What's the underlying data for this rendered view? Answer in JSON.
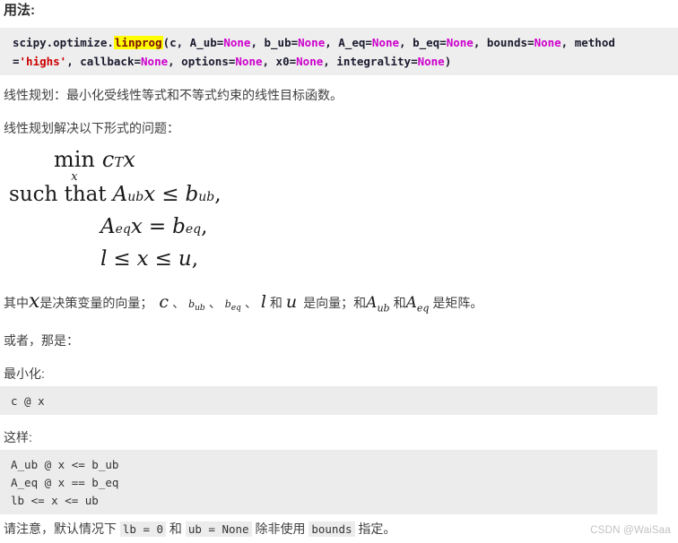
{
  "heading": "用法:",
  "signature": {
    "module_prefix": "scipy.optimize.",
    "func_name": "linprog",
    "open_paren": "(",
    "line1_segments": [
      {
        "t": "c, A_ub=",
        "k": "plain"
      },
      {
        "t": "None",
        "k": "none"
      },
      {
        "t": ", b_ub=",
        "k": "plain"
      },
      {
        "t": "None",
        "k": "none"
      },
      {
        "t": ", A_eq=",
        "k": "plain"
      },
      {
        "t": "None",
        "k": "none"
      },
      {
        "t": ", b_eq=",
        "k": "plain"
      },
      {
        "t": "None",
        "k": "none"
      },
      {
        "t": ", bounds=",
        "k": "plain"
      },
      {
        "t": "None",
        "k": "none"
      },
      {
        "t": ", method",
        "k": "plain"
      }
    ],
    "line2_segments": [
      {
        "t": "=",
        "k": "plain"
      },
      {
        "t": "'highs'",
        "k": "str"
      },
      {
        "t": ", callback=",
        "k": "plain"
      },
      {
        "t": "None",
        "k": "none"
      },
      {
        "t": ", options=",
        "k": "plain"
      },
      {
        "t": "None",
        "k": "none"
      },
      {
        "t": ", x0=",
        "k": "plain"
      },
      {
        "t": "None",
        "k": "none"
      },
      {
        "t": ", integrality=",
        "k": "plain"
      },
      {
        "t": "None",
        "k": "none"
      },
      {
        "t": ")",
        "k": "plain"
      }
    ],
    "highlight_color": "#ffff00",
    "none_color": "#cc00cc",
    "string_color": "#cc0000",
    "background": "#eeeeee"
  },
  "paragraphs": {
    "intro": "线性规划：最小化受线性等式和不等式约束的线性目标函数。",
    "solves": "线性规划解决以下形式的问题：",
    "or_that_is": "或者，那是：",
    "minimize": "最小化:",
    "such_that": "这样:"
  },
  "math_block": {
    "row1": {
      "op": "min",
      "limit": "x",
      "expr_c": "c",
      "expr_T": "T",
      "expr_x": "x"
    },
    "row2": {
      "lead": "such that",
      "A": "A",
      "Asub": "ub",
      "x": "x",
      "rel": "≤",
      "b": "b",
      "bsub": "ub",
      "punct": ","
    },
    "row3": {
      "A": "A",
      "Asub": "eq",
      "x": "x",
      "rel": "=",
      "b": "b",
      "bsub": "eq",
      "punct": ","
    },
    "row4": {
      "l": "l",
      "rel1": "≤",
      "x": "x",
      "rel2": "≤",
      "u": "u",
      "punct": ","
    }
  },
  "where_line": {
    "seg1": "其中",
    "var_x": "x",
    "seg2": "是决策变量的向量；",
    "var_c": "c",
    "sep1": "、",
    "var_b_ub_base": "b",
    "var_b_ub_sub": "ub",
    "sep2": "、",
    "var_b_eq_base": "b",
    "var_b_eq_sub": "eq",
    "sep3": "、",
    "var_l": "l",
    "seg3": "和",
    "var_u": "u",
    "seg4": "是向量；和",
    "var_A_ub_base": "A",
    "var_A_ub_sub": "ub",
    "seg5": "和",
    "var_A_eq_base": "A",
    "var_A_eq_sub": "eq",
    "seg6": "是矩阵。"
  },
  "code_blocks": {
    "objective": "c @ x",
    "constraints": "A_ub @ x <= b_ub\nA_eq @ x == b_eq\nlb <= x <= ub",
    "background": "#ececec"
  },
  "note": {
    "part1": "请注意，默认情况下 ",
    "code1": "lb = 0",
    "part2": " 和 ",
    "code2": "ub = None",
    "part3": " 除非使用 ",
    "code3": "bounds",
    "part4": " 指定。"
  },
  "watermark": "CSDN @WaiSaa"
}
